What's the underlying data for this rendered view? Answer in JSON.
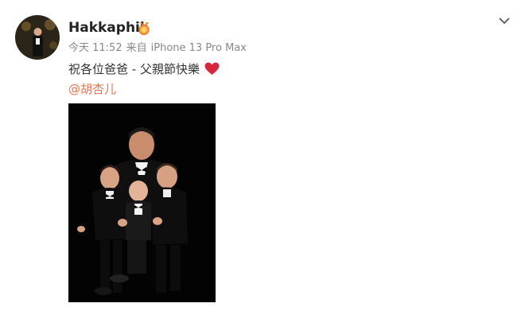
{
  "user": {
    "name": "Hakkaphil",
    "badge_icon": "verified-medal-icon"
  },
  "meta": {
    "time": "今天 11:52",
    "source_prefix": "来自",
    "device": "iPhone 13 Pro Max"
  },
  "post": {
    "text": "祝各位爸爸 - 父親節快樂",
    "emoji_icon": "red-heart-icon",
    "mention": "@胡杏儿"
  },
  "menu": {
    "icon": "chevron-down-icon"
  },
  "colors": {
    "mention": "#eb7350",
    "heart": "#d7263d",
    "meta": "#888888"
  }
}
